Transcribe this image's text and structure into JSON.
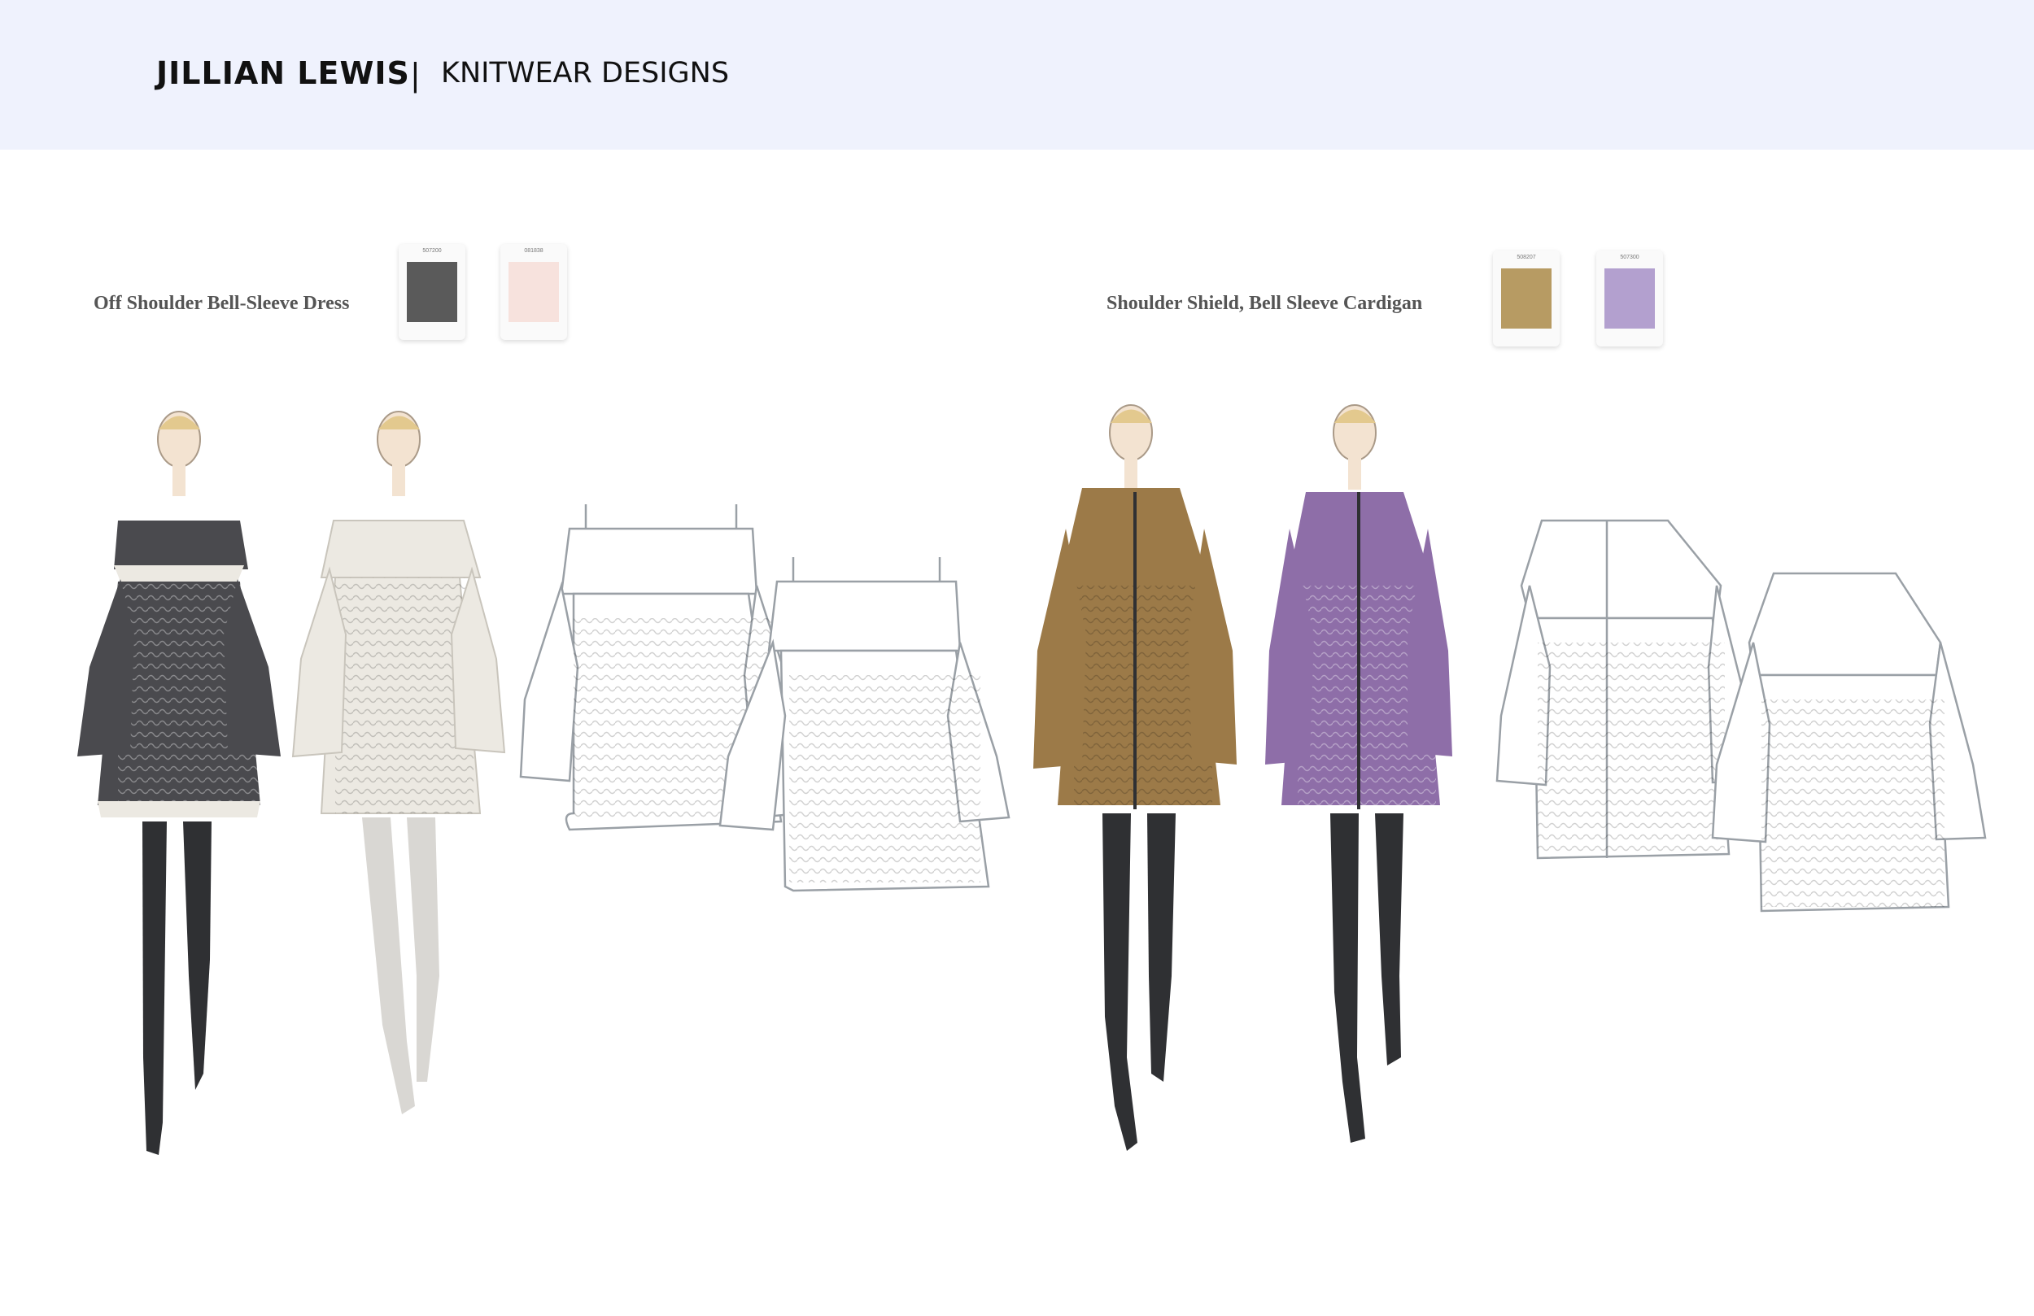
{
  "header": {
    "brand": "JILLIAN LEWIS",
    "separator": "|",
    "subtitle": "KNITWEAR DESIGNS"
  },
  "groups": [
    {
      "title": "Off Shoulder Bell-Sleeve Dress",
      "yarns": [
        {
          "code": "507200",
          "color": "#5a5a5a"
        },
        {
          "code": "081838",
          "color": "#f7e2dd"
        }
      ]
    },
    {
      "title": "Shoulder Shield, Bell Sleeve Cardigan",
      "yarns": [
        {
          "code": "508207",
          "color": "#b79b63"
        },
        {
          "code": "507300",
          "color": "#b3a0cf"
        }
      ]
    }
  ],
  "colors": {
    "charcoal": "#4a4a4e",
    "ivory": "#ece9e2",
    "camel": "#9c7a48",
    "lilac": "#8e6ea8",
    "boots": "#2f3033",
    "flat_line": "#9aa0a6"
  }
}
